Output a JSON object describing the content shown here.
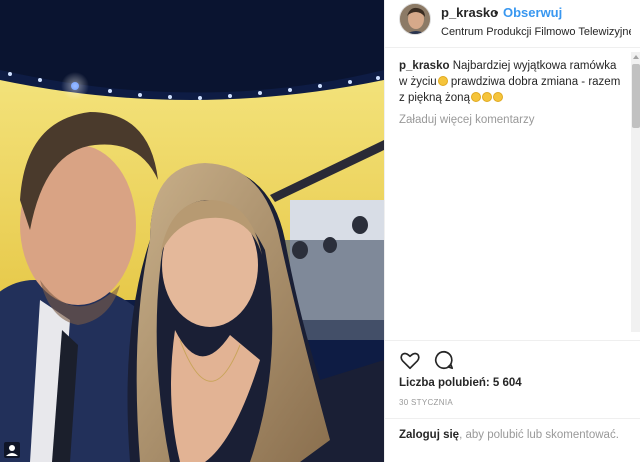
{
  "post": {
    "username": "p_krasko",
    "dot": "•",
    "follow_label": "Obserwuj",
    "location": "Centrum Produkcji Filmowo Telewizyjnej ..."
  },
  "caption": {
    "username": "p_krasko",
    "part1": "Najbardziej wyjątkowa ramówka w życiu",
    "part2": " prawdziwa dobra zmiana - razem z piękną żoną"
  },
  "comments": {
    "load_more": "Załaduj więcej komentarzy"
  },
  "actions": {
    "likes": "Liczba polubień: 5 604",
    "date": "30 STYCZNIA"
  },
  "login": {
    "link": "Zaloguj się",
    "rest": ", aby polubić lub skomentować."
  },
  "icons": {
    "like": "heart-icon",
    "comment": "comment-icon",
    "media_badge": "user-tag-icon"
  }
}
